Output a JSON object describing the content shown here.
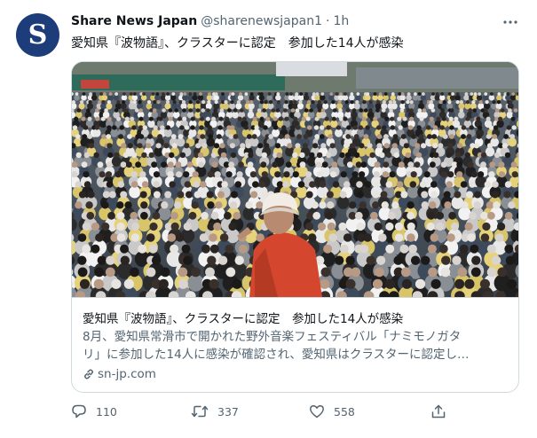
{
  "author": {
    "avatar_letter": "S",
    "display_name": "Share News Japan",
    "handle": "@sharenewsjapan1",
    "separator": "·",
    "time": "1h"
  },
  "tweet": {
    "text": "愛知県『波物語』、クラスターに認定　参加した14人が感染"
  },
  "card": {
    "title": "愛知県『波物語』、クラスターに認定　参加した14人が感染",
    "description_line1": "8月、愛知県常滑市で開かれた野外音楽フェスティバル「ナミモノガタ",
    "description_line2": "リ」に参加した14人に感染が確認され、愛知県はクラスターに認定し…",
    "domain": "sn-jp.com"
  },
  "actions": {
    "replies": "110",
    "retweets": "337",
    "likes": "558"
  },
  "colors": {
    "avatar_bg": "#1d3d7a",
    "secondary_text": "#536471",
    "border": "#cfd9de"
  },
  "icons": {
    "more": "more-horizontal-icon",
    "reply": "reply-icon",
    "retweet": "retweet-icon",
    "like": "heart-icon",
    "share": "share-icon",
    "link": "link-icon"
  }
}
